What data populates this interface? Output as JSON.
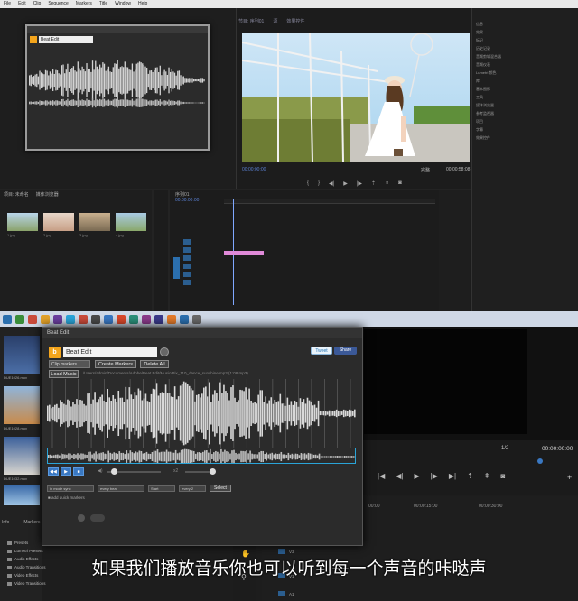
{
  "top": {
    "menu": [
      "File",
      "Edit",
      "Clip",
      "Sequence",
      "Markers",
      "Title",
      "Window",
      "Help"
    ],
    "program_monitor": {
      "tabs": [
        "节目: 序列01",
        "源",
        "效果控件"
      ],
      "timecode": "00:00:00:00",
      "fit": "完整",
      "duration": "00:00:58:08"
    },
    "beat_edit_small": {
      "title": "Beat Edit"
    },
    "project": {
      "tabs": [
        "项目: 未命名",
        "媒体浏览器"
      ],
      "clip_labels": [
        "1.jpg",
        "2.jpg",
        "3.jpg",
        "4.jpg"
      ]
    },
    "timeline": {
      "title": "序列01",
      "timecode": "00:00:00:00"
    },
    "right_panel_items": [
      "信息",
      "效果",
      "标记",
      "历史记录",
      "音频剪辑混合器",
      "音频仪表",
      "Lumetri 颜色",
      "库",
      "基本图形",
      "工具",
      "媒体浏览器",
      "参考监视器",
      "项目",
      "字幕",
      "效果控件"
    ]
  },
  "beat_edit": {
    "window_title": "Beat Edit",
    "logo": "b",
    "name": "Beat Edit",
    "tweet": "Tweet",
    "share": "Share",
    "select_value": "Clip markers",
    "create_markers": "Create Markers",
    "delete_all": "Delete All",
    "load_music": "Load Music",
    "file_path": "/Users/admin/Documents/Adobe/Beat Edit/Music/Pix_110_dance_sunshine.mp3 (1:08.mp3)",
    "vol_label": "◀)",
    "speed_label": "x2",
    "option_selects": [
      "in mode sync",
      "every beat",
      "Start",
      "every 2"
    ],
    "select_button": "Select",
    "checkbox_label": "add quick markers",
    "colors": {
      "accent": "#f4a51c",
      "wave": "#d9d9d9",
      "overview_border": "#2aa4d8",
      "play": "#3a78c2"
    }
  },
  "bottom": {
    "clip_labels": [
      "DUE1026.mov",
      "DUE1028.mov",
      "DUE1032.mov",
      "DUE1040.mov"
    ],
    "effects_tabs": [
      "Info",
      "Markers"
    ],
    "effects_folders": [
      "Presets",
      "Lumetri Presets",
      "Audio Effects",
      "Audio Transitions",
      "Video Effects",
      "Video Transitions"
    ],
    "fit": "1/2",
    "timecode": "00:00:00:00",
    "ruler": [
      "00:00",
      "00:00:15:00",
      "00:00:30:00"
    ],
    "track_labels": [
      "V3",
      "V2",
      "V1",
      "A1"
    ]
  },
  "caption": "如果我们播放音乐你也可以听到每一个声音的咔哒声"
}
